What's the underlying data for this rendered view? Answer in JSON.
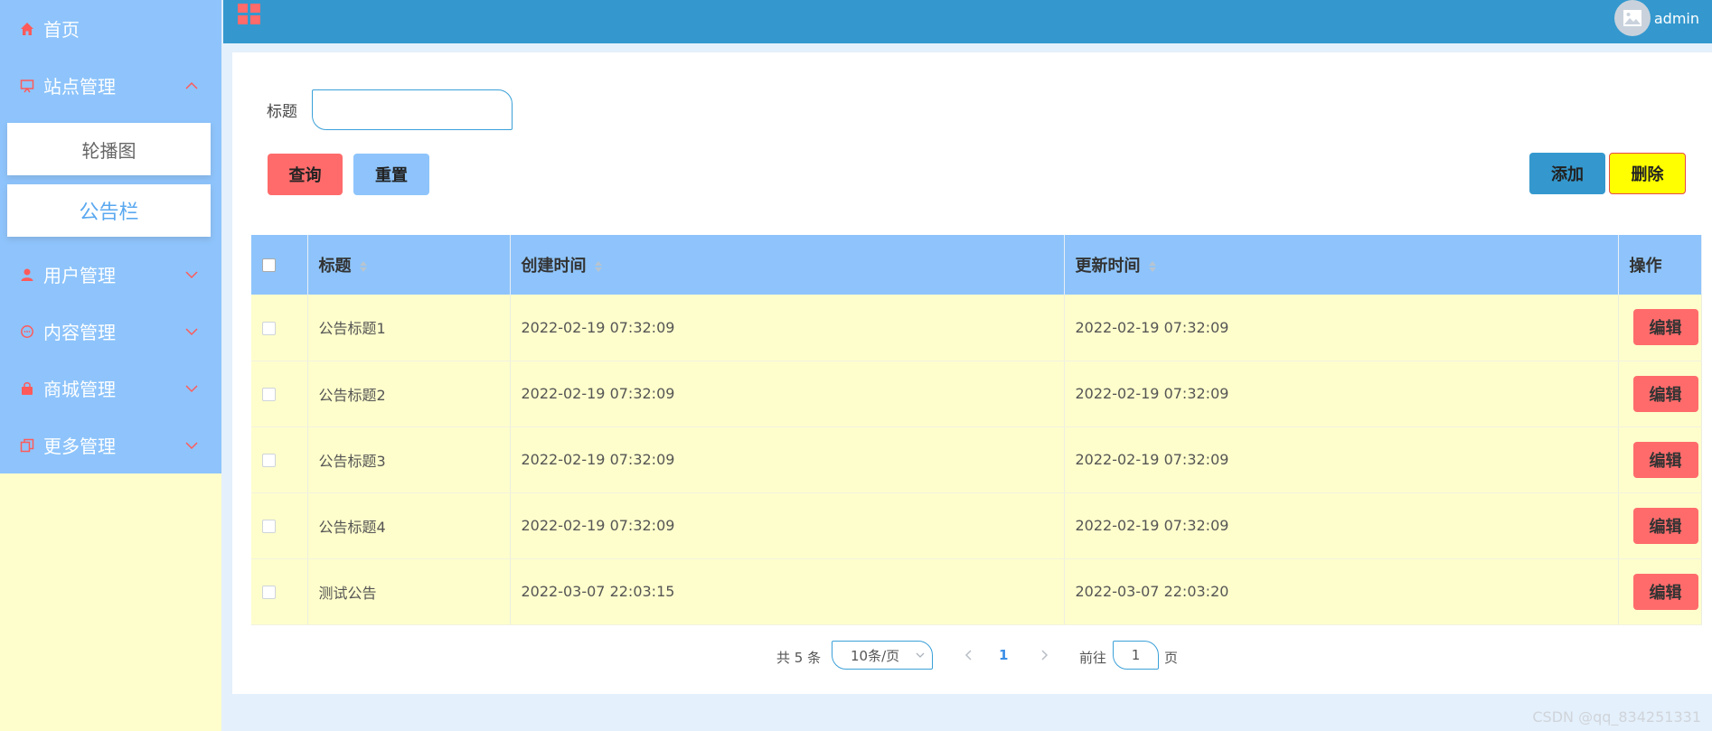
{
  "sidebar": {
    "items": [
      {
        "label": "首页"
      },
      {
        "label": "站点管理"
      },
      {
        "label": "用户管理"
      },
      {
        "label": "内容管理"
      },
      {
        "label": "商城管理"
      },
      {
        "label": "更多管理"
      }
    ],
    "submenu": [
      {
        "label": "轮播图"
      },
      {
        "label": "公告栏"
      }
    ]
  },
  "topbar": {
    "username": "admin"
  },
  "search": {
    "label": "标题",
    "value": "",
    "placeholder": ""
  },
  "buttons": {
    "query": "查询",
    "reset": "重置",
    "add": "添加",
    "delete": "删除"
  },
  "table": {
    "headers": [
      "标题",
      "创建时间",
      "更新时间",
      "操作"
    ],
    "rows": [
      {
        "title": "公告标题1",
        "created": "2022-02-19 07:32:09",
        "updated": "2022-02-19 07:32:09",
        "action": "编辑"
      },
      {
        "title": "公告标题2",
        "created": "2022-02-19 07:32:09",
        "updated": "2022-02-19 07:32:09",
        "action": "编辑"
      },
      {
        "title": "公告标题3",
        "created": "2022-02-19 07:32:09",
        "updated": "2022-02-19 07:32:09",
        "action": "编辑"
      },
      {
        "title": "公告标题4",
        "created": "2022-02-19 07:32:09",
        "updated": "2022-02-19 07:32:09",
        "action": "编辑"
      },
      {
        "title": "测试公告",
        "created": "2022-03-07 22:03:15",
        "updated": "2022-03-07 22:03:20",
        "action": "编辑"
      }
    ]
  },
  "pagination": {
    "total": "共 5 条",
    "page_size": "10条/页",
    "current_page": "1",
    "goto_label": "前往",
    "goto_value": "1",
    "goto_suffix": "页"
  },
  "watermark": "CSDN @qq_834251331",
  "colors": {
    "sidebar_bg": "#8ec4fb",
    "sidebar_base": "#fefecc",
    "topbar": "#3498ce",
    "accent_red": "#ff6b6b",
    "accent_yellow": "#ffff00",
    "table_row": "#fefecc",
    "active_sub": "#5aa8f0"
  },
  "icons": [
    "home-icon",
    "monitor-icon",
    "user-icon",
    "chat-icon",
    "bag-icon",
    "copy-icon",
    "grid-icon",
    "avatar-icon"
  ]
}
